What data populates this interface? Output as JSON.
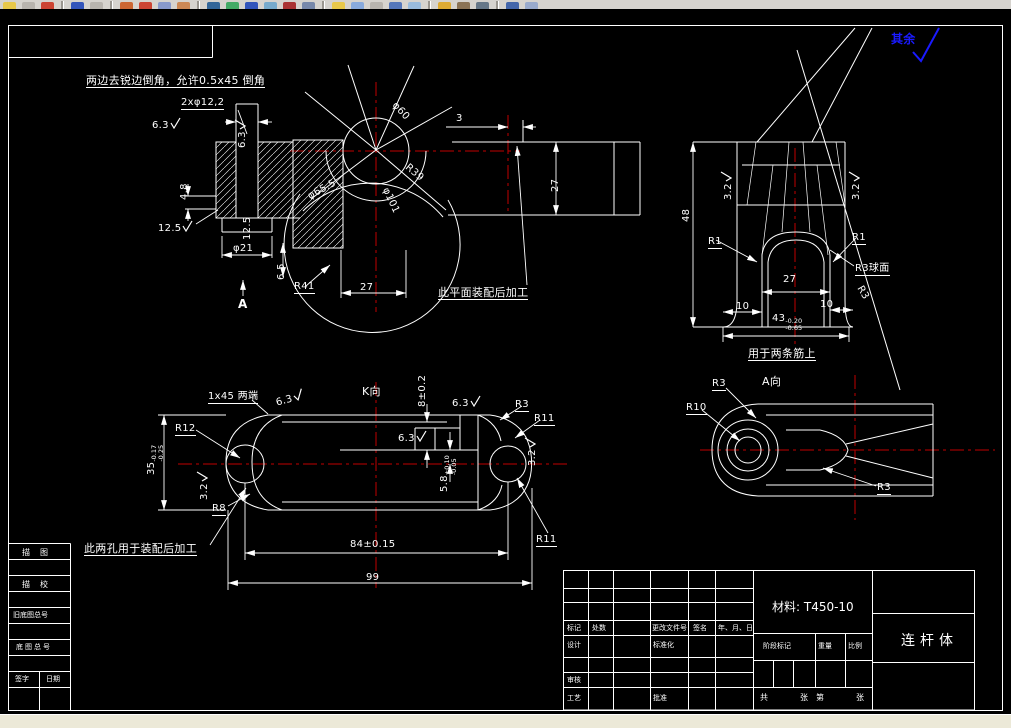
{
  "toolbar": {
    "bg_color": "#d6d3ce"
  },
  "statusbar": {
    "bg_color": "#ece9d8"
  },
  "drawing": {
    "colors": {
      "background": "#000000",
      "geometry": "#ffffff",
      "centerline": "#c00000",
      "general_note_blue": "#1a1aff"
    },
    "labels": [
      {
        "text": "两边去锐边倒角，允许0.5x45 倒角"
      },
      {
        "text": "2xφ12,2"
      },
      {
        "text": "6.3"
      },
      {
        "text": "6.3"
      },
      {
        "text": "φ60"
      },
      {
        "text": "3"
      },
      {
        "text": "27"
      },
      {
        "text": "φ65.5"
      },
      {
        "text": "R39"
      },
      {
        "text": "φ101"
      },
      {
        "text": "4.8"
      },
      {
        "text": "12.5"
      },
      {
        "text": "12.5"
      },
      {
        "text": "φ21"
      },
      {
        "text": "6.5"
      },
      {
        "text": "R41"
      },
      {
        "text": "A"
      },
      {
        "text": "27"
      },
      {
        "text": "此平面装配后加工"
      },
      {
        "text": "其余"
      },
      {
        "text": "48"
      },
      {
        "text": "3.2"
      },
      {
        "text": "3.2"
      },
      {
        "text": "R1"
      },
      {
        "text": "R1"
      },
      {
        "text": "R3球面"
      },
      {
        "text": "R3"
      },
      {
        "text": "27"
      },
      {
        "text": "10"
      },
      {
        "text": "10"
      },
      {
        "text": "43",
        "sup": "-0.20",
        "sub": "-0.65"
      },
      {
        "text": "用于两条筋上"
      },
      {
        "text": "1x45 两端"
      },
      {
        "text": "6.3"
      },
      {
        "text": "R12"
      },
      {
        "text": "35",
        "sup": "-0.17",
        "sub": "-0.25"
      },
      {
        "text": "3.2"
      },
      {
        "text": "R8"
      },
      {
        "text": "K向"
      },
      {
        "text": "8±0.2"
      },
      {
        "text": "6.3"
      },
      {
        "text": "6.3"
      },
      {
        "text": "R3"
      },
      {
        "text": "R11"
      },
      {
        "text": "3.2"
      },
      {
        "text": "5.8",
        "sup": "+0.10",
        "sub": "-0.05"
      },
      {
        "text": "此两孔用于装配后加工"
      },
      {
        "text": "R11"
      },
      {
        "text": "84±0.15"
      },
      {
        "text": "99"
      },
      {
        "text": "R3"
      },
      {
        "text": "A向"
      },
      {
        "text": "R10"
      },
      {
        "text": "R3"
      }
    ]
  },
  "title_block": {
    "material": "材料: T450-10",
    "part_name": "连杆体",
    "cells": {
      "mark": "标记",
      "count": "处数",
      "change_doc": "更改文件号",
      "sign": "签名",
      "date": "年、月、日",
      "design": "设计",
      "standardize": "标准化",
      "check": "审核",
      "process": "工艺",
      "approve": "批准",
      "stage": "阶段标记",
      "weight": "重量",
      "scale": "比例",
      "sheet_total": "共",
      "sheet_unit1": "张",
      "sheet_no": "第",
      "sheet_unit2": "张"
    }
  },
  "margin_table": {
    "rows": [
      "描图",
      "描校",
      "旧底图总号",
      "底图总号"
    ],
    "sign": "签字",
    "date": "日期"
  }
}
